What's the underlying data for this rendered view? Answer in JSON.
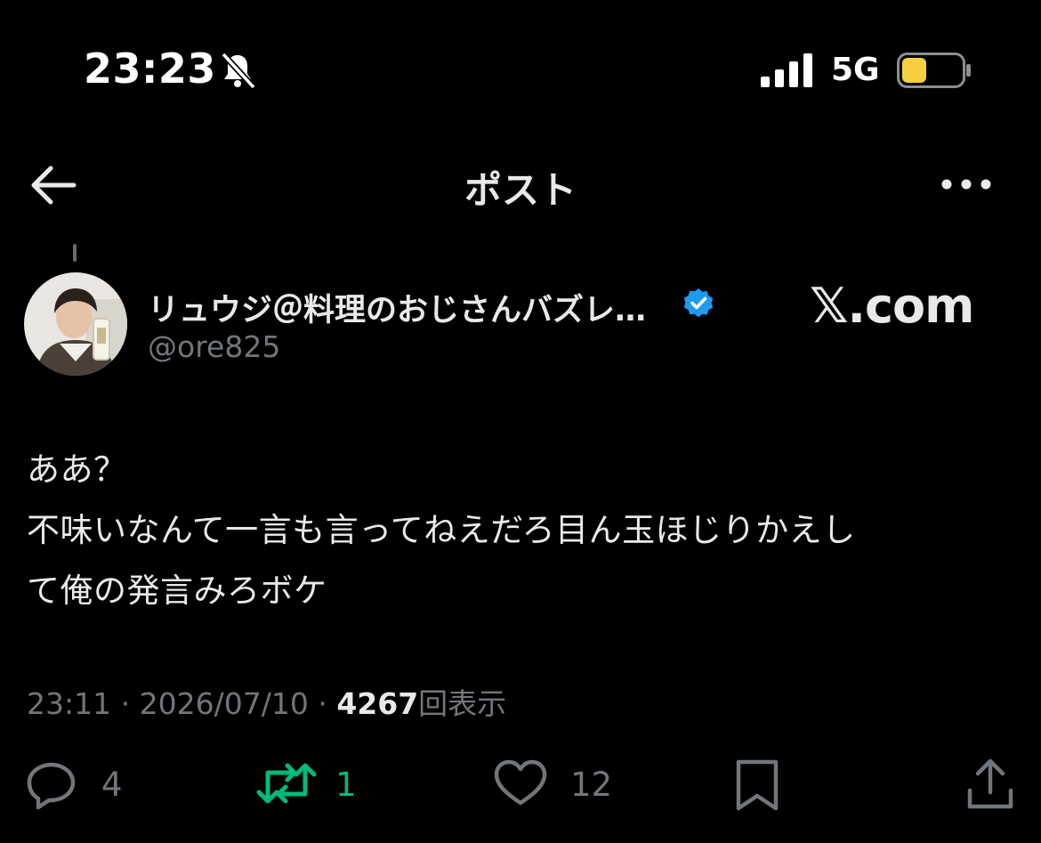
{
  "status_bar": {
    "time": "23:23",
    "network": "5G"
  },
  "header": {
    "title": "ポスト"
  },
  "post": {
    "author_name": "リュウジ＠料理のおじさんバズレ…",
    "handle": "@ore825",
    "watermark": "𝕏.com",
    "body_lines": [
      "ああ？",
      "不味いなんて一言も言ってねえだろ目ん玉ほじりかえし",
      "て俺の発言みろボケ"
    ],
    "meta": {
      "time": "23:11",
      "separator": "·",
      "date": "2026/07/10",
      "views": "4267",
      "views_label": "回表示"
    },
    "actions": {
      "replies": "4",
      "reposts": "1",
      "likes": "12"
    }
  },
  "colors": {
    "background": "#000000",
    "text": "#e7e9ea",
    "secondary": "#71767b",
    "verified": "#1d9bf0",
    "repost_active": "#00ba7c",
    "battery": "#f4d03f"
  }
}
